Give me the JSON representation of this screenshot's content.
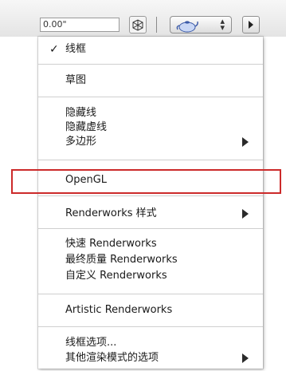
{
  "toolbar": {
    "numeric_value": "0.00\""
  },
  "menu": {
    "items": [
      {
        "label": "线框",
        "checked": true
      },
      {
        "label": "草图"
      },
      {
        "label": "隐藏线"
      },
      {
        "label": "隐藏虚线"
      },
      {
        "label": "多边形",
        "submenu": true
      },
      {
        "label": "OpenGL"
      },
      {
        "label": "Renderworks 样式",
        "submenu": true
      },
      {
        "label": "快速 Renderworks"
      },
      {
        "label": "最终质量 Renderworks"
      },
      {
        "label": "自定义 Renderworks"
      },
      {
        "label": "Artistic Renderworks"
      },
      {
        "label": "线框选项..."
      },
      {
        "label": "其他渲染模式的选项",
        "submenu": true
      }
    ],
    "checkmark": "✓"
  },
  "colors": {
    "highlight_outline": "#cc2a2a",
    "divider": "#cfcfcf"
  }
}
